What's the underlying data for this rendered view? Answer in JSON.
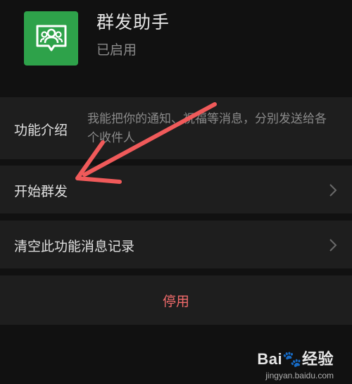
{
  "app": {
    "title": "群发助手",
    "status": "已启用",
    "icon": "group-users-icon",
    "accent_color": "#2ea24a"
  },
  "rows": {
    "intro": {
      "label": "功能介绍",
      "description": "我能把你的通知、祝福等消息，分别发送给各个收件人"
    },
    "start": {
      "label": "开始群发",
      "icon": "chevron-right-icon"
    },
    "clear": {
      "label": "清空此功能消息记录",
      "icon": "chevron-right-icon"
    },
    "disable": {
      "label": "停用",
      "color": "#f16b6b"
    }
  },
  "annotation": {
    "arrow_color": "#f05a5a",
    "icon": "arrow-icon"
  },
  "watermark": {
    "brand_prefix": "Bai",
    "brand_suffix": "经验",
    "url": "jingyan.baidu.com"
  }
}
